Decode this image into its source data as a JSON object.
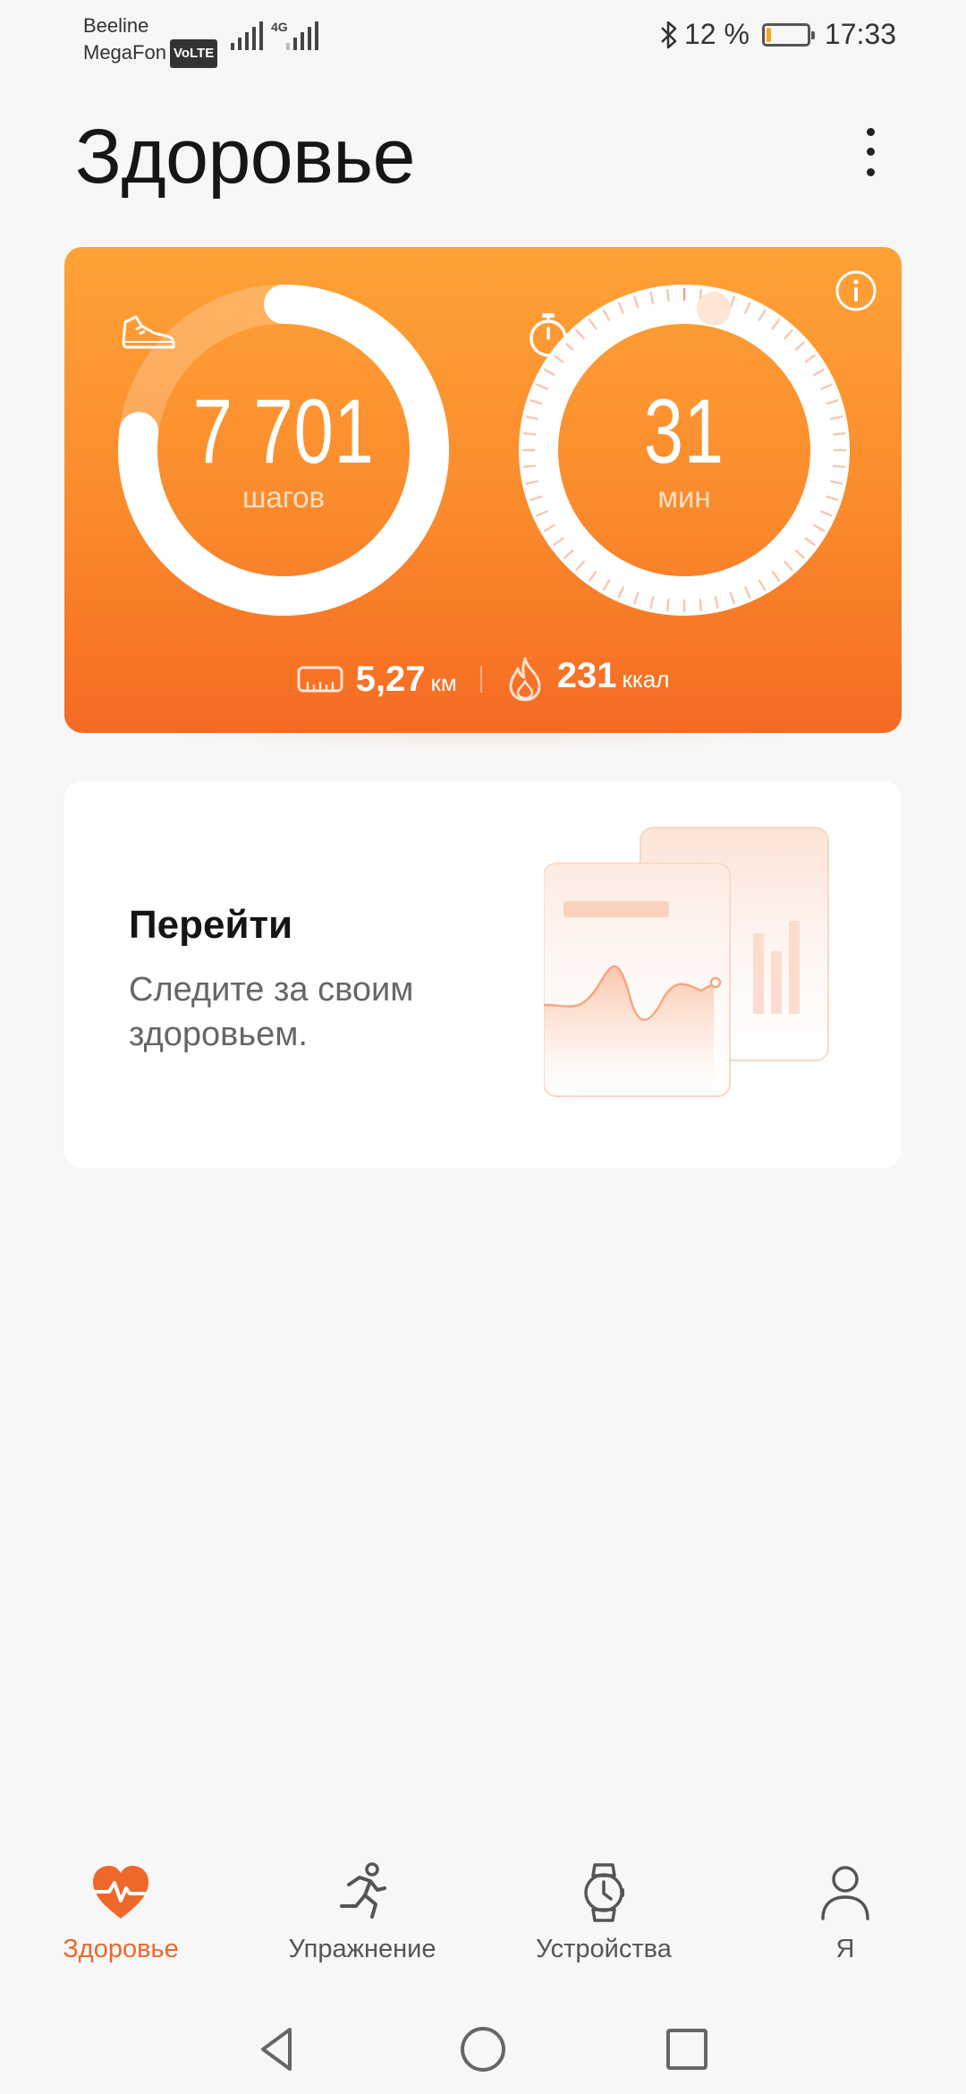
{
  "status_bar": {
    "carrier_1": "Beeline",
    "carrier_2": "MegaFon",
    "volte": "VoLTE",
    "network": "4G",
    "battery_percent": "12 %",
    "battery_level": 0.12,
    "time": "17:33"
  },
  "header": {
    "title": "Здоровье",
    "menu_icon": "more-vert-icon"
  },
  "activity": {
    "steps_value": "7 701",
    "steps_unit": "шагов",
    "steps_goal_progress": 0.77,
    "steps_icon": "sneaker-icon",
    "time_value": "31",
    "time_unit": "мин",
    "time_icon": "stopwatch-icon",
    "distance_value": "5,27",
    "distance_unit": "км",
    "distance_icon": "ruler-icon",
    "calories_value": "231",
    "calories_unit": "ккал",
    "calories_icon": "flame-icon",
    "info_icon": "info-icon",
    "accent_color": "#fa8a2c"
  },
  "promo": {
    "title": "Перейти",
    "description": "Следите за своим здоровьем."
  },
  "bottom_nav": {
    "items": [
      {
        "label": "Здоровье",
        "icon": "heart-pulse-icon",
        "active": true
      },
      {
        "label": "Упражнение",
        "icon": "running-icon",
        "active": false
      },
      {
        "label": "Устройства",
        "icon": "watch-icon",
        "active": false
      },
      {
        "label": "Я",
        "icon": "person-icon",
        "active": false
      }
    ],
    "active_color": "#f0672a"
  },
  "system_nav": {
    "back_icon": "back-triangle-icon",
    "home_icon": "home-circle-icon",
    "recents_icon": "recents-square-icon"
  }
}
